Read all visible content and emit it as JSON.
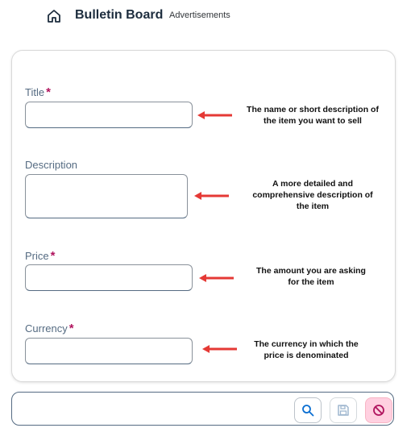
{
  "header": {
    "title": "Bulletin Board",
    "subtitle": "Advertisements",
    "icon": "home-icon"
  },
  "form": {
    "fields": [
      {
        "label": "Title",
        "required": true,
        "type": "input",
        "value": "",
        "annotation": "The name or short description of the item you want to sell"
      },
      {
        "label": "Description",
        "required": false,
        "type": "textarea",
        "value": "",
        "annotation": "A more detailed and comprehensive description of the item"
      },
      {
        "label": "Price",
        "required": true,
        "type": "input",
        "value": "",
        "annotation": "The amount you are asking for the item"
      },
      {
        "label": "Currency",
        "required": true,
        "type": "input",
        "value": "",
        "annotation": "The currency in which the price is denominated"
      }
    ],
    "required_mark": "*"
  },
  "annotations": {
    "title_lines": [
      "The name or short description of",
      "the item you want to sell"
    ],
    "description_lines": [
      "A more detailed and",
      "comprehensive description of",
      "the item"
    ],
    "price_lines": [
      "The amount you are asking",
      "for the item"
    ],
    "currency_lines": [
      "The currency in which the",
      "price is denominated"
    ],
    "arrow_color": "#e53935"
  },
  "toolbar": {
    "buttons": [
      {
        "icon": "search-icon",
        "enabled": true
      },
      {
        "icon": "save-icon",
        "enabled": false
      },
      {
        "icon": "cancel-icon",
        "enabled": true
      }
    ]
  },
  "colors": {
    "required": "#b0145e",
    "cancel_bg": "#ffd0e0",
    "accent": "#0a6ed1"
  }
}
